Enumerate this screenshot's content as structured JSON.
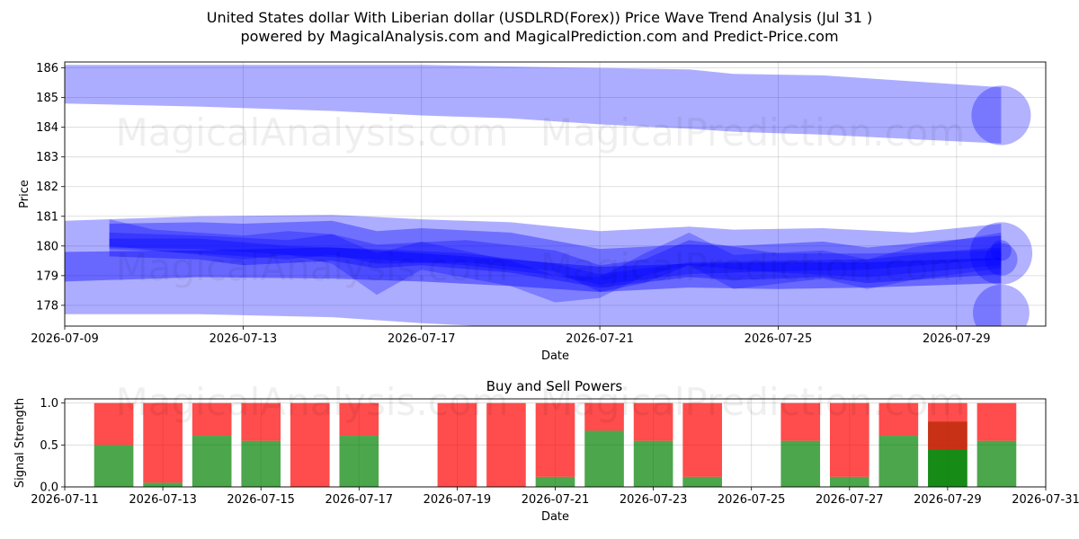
{
  "header": {
    "title": "United States dollar With Liberian dollar (USDLRD(Forex)) Price Wave Trend Analysis (Jul 31 )",
    "subtitle": "powered by MagicalAnalysis.com and MagicalPrediction.com and Predict-Price.com"
  },
  "watermarks": [
    "MagicalAnalysis.com",
    "MagicalPrediction.com"
  ],
  "colors": {
    "wave": "#0000ff",
    "buy": "#008000",
    "sell": "#ff0000",
    "grid": "#b0b0b0"
  },
  "chart_data": [
    {
      "type": "area",
      "title": "",
      "xlabel": "Date",
      "ylabel": "Price",
      "x_range": [
        "2026-07-09",
        "2026-07-31"
      ],
      "ylim": [
        177.3,
        186.2
      ],
      "x_ticks": [
        "2026-07-09",
        "2026-07-13",
        "2026-07-17",
        "2026-07-21",
        "2026-07-25",
        "2026-07-29"
      ],
      "y_ticks": [
        178,
        179,
        180,
        181,
        182,
        183,
        184,
        185,
        186
      ],
      "grid": true,
      "series": [
        {
          "x": [
            "2026-07-09",
            "2026-07-12",
            "2026-07-15",
            "2026-07-17",
            "2026-07-19",
            "2026-07-21",
            "2026-07-23",
            "2026-07-24",
            "2026-07-26",
            "2026-07-28",
            "2026-07-30"
          ],
          "upper": [
            186.1,
            186.1,
            186.1,
            186.1,
            186.05,
            186.0,
            185.95,
            185.8,
            185.75,
            185.55,
            185.35
          ],
          "lower": [
            184.8,
            184.7,
            184.55,
            184.4,
            184.3,
            184.1,
            183.95,
            183.85,
            183.75,
            183.6,
            183.45
          ],
          "opacity": 0.32
        },
        {
          "x": [
            "2026-07-09",
            "2026-07-12",
            "2026-07-15",
            "2026-07-17",
            "2026-07-19",
            "2026-07-21",
            "2026-07-23",
            "2026-07-24",
            "2026-07-26",
            "2026-07-28",
            "2026-07-30"
          ],
          "upper": [
            180.85,
            181.0,
            181.05,
            180.9,
            180.8,
            180.5,
            180.65,
            180.55,
            180.6,
            180.45,
            180.75
          ],
          "lower": [
            177.7,
            177.7,
            177.6,
            177.4,
            177.25,
            177.2,
            177.2,
            177.2,
            177.2,
            177.2,
            177.3
          ],
          "opacity": 0.32
        },
        {
          "x": [
            "2026-07-09",
            "2026-07-12",
            "2026-07-15",
            "2026-07-17",
            "2026-07-19",
            "2026-07-21",
            "2026-07-23",
            "2026-07-25",
            "2026-07-27",
            "2026-07-30"
          ],
          "upper": [
            179.8,
            179.85,
            179.95,
            179.75,
            179.55,
            179.3,
            179.4,
            179.45,
            179.45,
            179.6
          ],
          "lower": [
            178.8,
            178.95,
            178.9,
            178.8,
            178.65,
            178.45,
            178.6,
            178.55,
            178.6,
            178.75
          ],
          "opacity": 0.4
        },
        {
          "x": [
            "2026-07-10",
            "2026-07-12",
            "2026-07-13",
            "2026-07-15",
            "2026-07-16",
            "2026-07-17",
            "2026-07-19",
            "2026-07-21",
            "2026-07-23",
            "2026-07-24",
            "2026-07-26",
            "2026-07-27",
            "2026-07-30"
          ],
          "upper": [
            180.75,
            180.8,
            180.75,
            180.85,
            180.5,
            180.6,
            180.45,
            179.9,
            180.05,
            180.0,
            180.15,
            179.95,
            180.35
          ],
          "lower": [
            179.65,
            179.55,
            179.35,
            179.5,
            179.25,
            179.35,
            179.1,
            178.6,
            178.95,
            178.85,
            178.95,
            178.75,
            179.05
          ],
          "opacity": 0.35
        },
        {
          "x": [
            "2026-07-10",
            "2026-07-12",
            "2026-07-14",
            "2026-07-15",
            "2026-07-16",
            "2026-07-18",
            "2026-07-20",
            "2026-07-21",
            "2026-07-22",
            "2026-07-23",
            "2026-07-25",
            "2026-07-27",
            "2026-07-30"
          ],
          "upper": [
            180.45,
            180.35,
            180.2,
            180.4,
            180.05,
            180.2,
            179.85,
            179.35,
            179.55,
            180.2,
            179.75,
            179.75,
            179.85
          ],
          "lower": [
            179.9,
            179.75,
            179.55,
            179.7,
            179.4,
            179.45,
            179.15,
            178.45,
            178.75,
            179.35,
            179.1,
            178.95,
            179.35
          ],
          "opacity": 0.3
        },
        {
          "x": [
            "2026-07-10",
            "2026-07-11",
            "2026-07-13",
            "2026-07-14",
            "2026-07-15",
            "2026-07-16",
            "2026-07-17",
            "2026-07-19",
            "2026-07-20",
            "2026-07-21",
            "2026-07-22",
            "2026-07-23",
            "2026-07-24",
            "2026-07-26",
            "2026-07-27",
            "2026-07-28",
            "2026-07-30"
          ],
          "upper": [
            180.9,
            180.55,
            180.35,
            180.5,
            180.4,
            179.75,
            180.15,
            179.5,
            179.0,
            178.95,
            179.75,
            180.45,
            179.7,
            179.85,
            179.55,
            179.95,
            180.45
          ],
          "lower": [
            180.0,
            179.85,
            179.55,
            179.7,
            179.4,
            178.35,
            179.2,
            178.65,
            178.1,
            178.25,
            179.0,
            179.35,
            178.55,
            178.9,
            178.55,
            178.85,
            179.25
          ],
          "opacity": 0.28
        },
        {
          "x": [
            "2026-07-10",
            "2026-07-12",
            "2026-07-14",
            "2026-07-16",
            "2026-07-18",
            "2026-07-20",
            "2026-07-21",
            "2026-07-23",
            "2026-07-25",
            "2026-07-27",
            "2026-07-29",
            "2026-07-30"
          ],
          "upper": [
            180.25,
            180.25,
            180.0,
            179.9,
            179.75,
            179.4,
            179.05,
            179.45,
            179.5,
            179.55,
            179.85,
            179.95
          ],
          "lower": [
            179.95,
            179.9,
            179.7,
            179.55,
            179.35,
            179.0,
            178.7,
            179.05,
            179.15,
            179.2,
            179.45,
            179.55
          ],
          "opacity": 0.32
        }
      ],
      "bubbles": [
        {
          "x": "2026-07-30",
          "y": 184.4,
          "r": 1.0
        },
        {
          "x": "2026-07-30",
          "y": 179.75,
          "r": 1.05
        },
        {
          "x": "2026-07-30",
          "y": 177.75,
          "r": 0.95
        },
        {
          "x": "2026-07-30",
          "y": 179.55,
          "r": 0.55
        },
        {
          "x": "2026-07-30",
          "y": 179.85,
          "r": 0.35
        }
      ]
    },
    {
      "type": "bar",
      "title": "Buy and Sell Powers",
      "xlabel": "Date",
      "ylabel": "Signal Strength",
      "x_range": [
        "2026-07-11",
        "2026-07-31"
      ],
      "ylim": [
        0,
        1.05
      ],
      "x_ticks": [
        "2026-07-11",
        "2026-07-13",
        "2026-07-15",
        "2026-07-17",
        "2026-07-19",
        "2026-07-21",
        "2026-07-23",
        "2026-07-25",
        "2026-07-27",
        "2026-07-29",
        "2026-07-31"
      ],
      "y_ticks": [
        0.0,
        0.5,
        1.0
      ],
      "grid": true,
      "categories": [
        "2026-07-12",
        "2026-07-13",
        "2026-07-14",
        "2026-07-15",
        "2026-07-16",
        "2026-07-17",
        "2026-07-19",
        "2026-07-20",
        "2026-07-21",
        "2026-07-22",
        "2026-07-23",
        "2026-07-24",
        "2026-07-26",
        "2026-07-27",
        "2026-07-28",
        "2026-07-29",
        "2026-07-30"
      ],
      "series": [
        {
          "name": "",
          "values": [
            0.5,
            0.05,
            0.61,
            0.55,
            0.0,
            0.61,
            0.0,
            0.0,
            0.12,
            0.67,
            0.55,
            0.12,
            0.55,
            0.12,
            0.61,
            0.78,
            0.55
          ]
        },
        {
          "name": "",
          "values": [
            0.5,
            0.95,
            0.39,
            0.45,
            1.0,
            0.39,
            1.0,
            1.0,
            0.88,
            0.33,
            0.45,
            0.88,
            0.45,
            0.88,
            0.39,
            0.22,
            0.45
          ]
        }
      ],
      "overlay": {
        "x": "2026-07-29",
        "buy": 0.45,
        "sell": 0.33
      }
    }
  ]
}
